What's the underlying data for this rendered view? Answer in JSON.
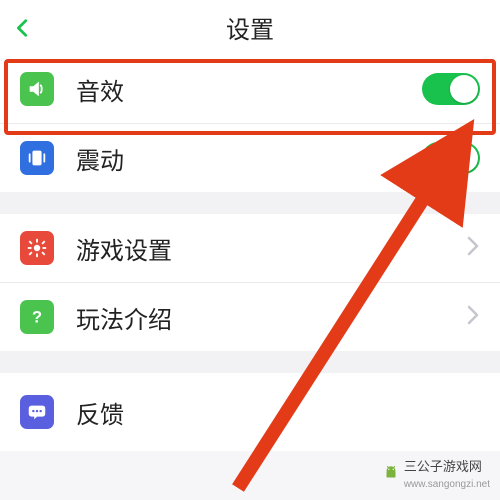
{
  "header": {
    "title": "设置"
  },
  "rows": {
    "sound": {
      "label": "音效",
      "icon": "sound-icon",
      "color": "#4bc34f",
      "type": "toggle",
      "on": true
    },
    "vibrate": {
      "label": "震动",
      "icon": "vibrate-icon",
      "color": "#2f6fe0",
      "type": "toggle",
      "on": true
    },
    "game": {
      "label": "游戏设置",
      "icon": "gear-icon",
      "color": "#e74a3b",
      "type": "nav"
    },
    "howto": {
      "label": "玩法介绍",
      "icon": "question-icon",
      "color": "#4bc34f",
      "type": "nav"
    },
    "feedback": {
      "label": "反馈",
      "icon": "chat-icon",
      "color": "#5a5fe0",
      "type": "nav"
    }
  },
  "watermark": {
    "text": "三公子游戏网",
    "url": "www.sangongzi.net"
  },
  "colors": {
    "accent": "#19c24d",
    "highlight": "#e33b18"
  }
}
